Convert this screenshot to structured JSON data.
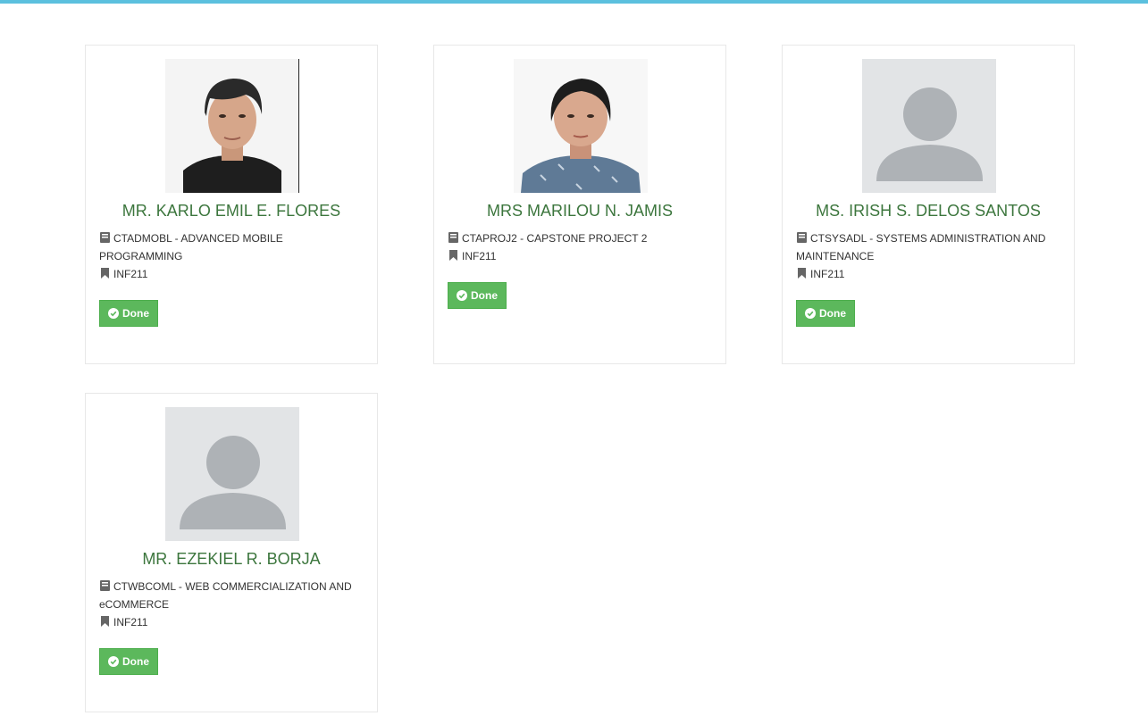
{
  "teachers": [
    {
      "name": "MR. KARLO EMIL E. FLORES",
      "subject": "CTADMOBL - ADVANCED MOBILE PROGRAMMING",
      "section": "INF211",
      "button_label": "Done",
      "photo": "portrait-male"
    },
    {
      "name": "MRS MARILOU N. JAMIS",
      "subject": "CTAPROJ2 - CAPSTONE PROJECT 2",
      "section": "INF211",
      "button_label": "Done",
      "photo": "portrait-female"
    },
    {
      "name": "MS. IRISH S. DELOS SANTOS",
      "subject": "CTSYSADL - SYSTEMS ADMINISTRATION AND MAINTENANCE",
      "section": "INF211",
      "button_label": "Done",
      "photo": "placeholder-avatar"
    },
    {
      "name": "MR. EZEKIEL R. BORJA",
      "subject": "CTWBCOML - WEB COMMERCIALIZATION AND eCOMMERCE",
      "section": "INF211",
      "button_label": "Done",
      "photo": "placeholder-avatar"
    }
  ],
  "colors": {
    "accent_bar": "#5bc0de",
    "name_text": "#3c763d",
    "button": "#5cb85c"
  },
  "icons": {
    "subject": "book-icon",
    "section": "bookmark-icon",
    "button": "check-circle-icon"
  }
}
